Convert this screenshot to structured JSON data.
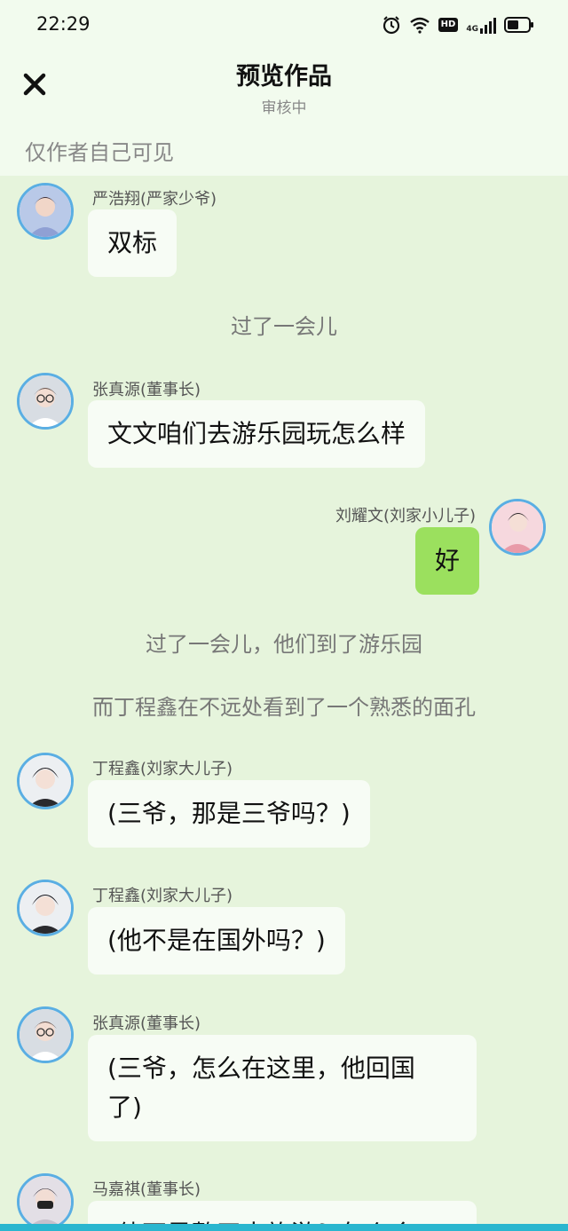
{
  "status_bar": {
    "time": "22:29",
    "icons": [
      "alarm-icon",
      "wifi-icon",
      "hd-icon",
      "signal-icon",
      "battery-icon"
    ],
    "hd_label": "HD",
    "net_label": "4G"
  },
  "header": {
    "title": "预览作品",
    "subtitle": "审核中",
    "visibility": "仅作者自己可见"
  },
  "messages": [
    {
      "sender": "严浩翔(严家少爷)",
      "text": "双标"
    },
    {
      "narration": "过了一会儿"
    },
    {
      "sender": "张真源(董事长)",
      "text": "文文咱们去游乐园玩怎么样"
    },
    {
      "sender": "刘耀文(刘家小儿子)",
      "text": "好",
      "self": true
    },
    {
      "narration": "过了一会儿，他们到了游乐园"
    },
    {
      "narration": "而丁程鑫在不远处看到了一个熟悉的面孔"
    },
    {
      "sender": "丁程鑫(刘家大儿子)",
      "text": "(三爷，那是三爷吗？)"
    },
    {
      "sender": "丁程鑫(刘家大儿子)",
      "text": "(他不是在国外吗？)"
    },
    {
      "sender": "张真源(董事长)",
      "text_lines": [
        "(三爷，怎么在这里，他回国",
        "了)"
      ]
    },
    {
      "sender": "马嘉祺(董事长)",
      "text": "(他不是整天去旅游？怎么会"
    }
  ],
  "colors": {
    "background": "#e6f4dc",
    "header_bg": "#f2fbee",
    "avatar_border": "#5aaee3",
    "self_bubble": "#9be05e",
    "bubble": "#f7fcf5"
  }
}
